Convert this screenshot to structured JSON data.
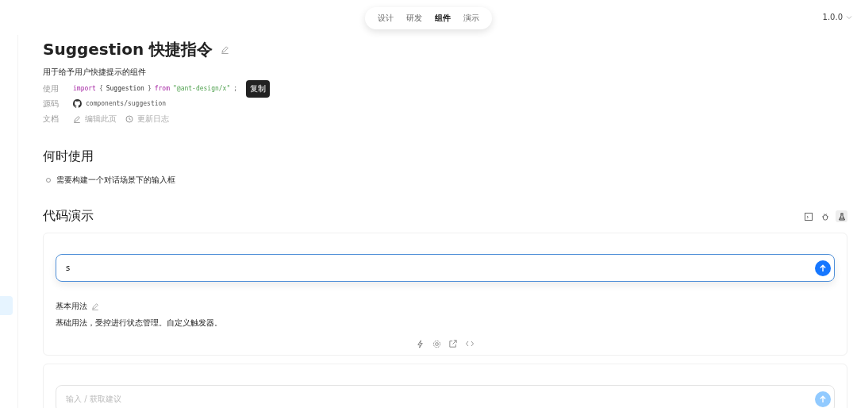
{
  "nav": {
    "items": [
      {
        "label": "设计",
        "selected": false
      },
      {
        "label": "研发",
        "selected": false
      },
      {
        "label": "组件",
        "selected": true
      },
      {
        "label": "演示",
        "selected": false
      }
    ]
  },
  "version": "1.0.0",
  "page": {
    "title": "Suggestion 快捷指令",
    "subtitle": "用于给予用户快捷提示的组件",
    "meta": [
      {
        "kind": "code",
        "label": "使用",
        "tokens": [
          {
            "kind": "keyword",
            "text": "import"
          },
          {
            "kind": "punct",
            "text": "{"
          },
          {
            "kind": "plain",
            "text": "Suggestion"
          },
          {
            "kind": "punct",
            "text": "}"
          },
          {
            "kind": "keyword",
            "text": "from"
          },
          {
            "kind": "string",
            "text": "\"@ant-design/x\""
          },
          {
            "kind": "punct",
            "text": ";"
          }
        ],
        "tooltip": "复制"
      },
      {
        "kind": "source",
        "label": "源码",
        "text": "components/suggestion"
      },
      {
        "kind": "links",
        "label": "文档",
        "links": [
          "编辑此页",
          "更新日志"
        ]
      }
    ]
  },
  "when": {
    "heading": "何时使用",
    "bullets": [
      "需要构建一个对话场景下的输入框"
    ]
  },
  "demos": {
    "heading": "代码演示",
    "view_toggles": [
      {
        "selected": false
      },
      {
        "selected": false
      },
      {
        "selected": true
      }
    ],
    "cards": [
      {
        "value": "s",
        "focused": true,
        "send_disabled": false,
        "title": "基本用法",
        "description": "基础用法，受控进行状态管理。自定义触发器。"
      },
      {
        "placeholder": "输入 / 获取建议",
        "focused": false,
        "send_disabled": true
      }
    ]
  }
}
